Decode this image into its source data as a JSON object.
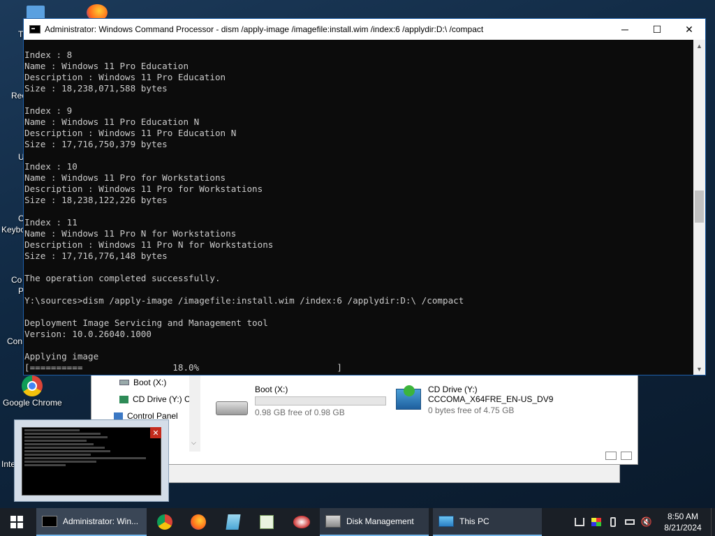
{
  "desktop": {
    "icons": [
      {
        "label": "Google Chrome"
      }
    ],
    "partial_labels": [
      "T",
      "Rec",
      "U",
      "C",
      "Keybo",
      "Co",
      "P",
      "Con",
      "Inte"
    ]
  },
  "cmd": {
    "title": "Administrator: Windows Command Processor - dism  /apply-image /imagefile:install.wim /index:6 /applydir:D:\\ /compact",
    "buttons": {
      "minimize": "─",
      "maximize": "☐",
      "close": "✕"
    },
    "lines": [
      "Index : 8",
      "Name : Windows 11 Pro Education",
      "Description : Windows 11 Pro Education",
      "Size : 18,238,071,588 bytes",
      "",
      "Index : 9",
      "Name : Windows 11 Pro Education N",
      "Description : Windows 11 Pro Education N",
      "Size : 17,716,750,379 bytes",
      "",
      "Index : 10",
      "Name : Windows 11 Pro for Workstations",
      "Description : Windows 11 Pro for Workstations",
      "Size : 18,238,122,226 bytes",
      "",
      "Index : 11",
      "Name : Windows 11 Pro N for Workstations",
      "Description : Windows 11 Pro N for Workstations",
      "Size : 17,716,776,148 bytes",
      "",
      "The operation completed successfully.",
      "",
      "Y:\\sources>dism /apply-image /imagefile:install.wim /index:6 /applydir:D:\\ /compact",
      "",
      "Deployment Image Servicing and Management tool",
      "Version: 10.0.26040.1000",
      "",
      "Applying image",
      "[==========                 18.0%                          ]"
    ],
    "progress": 0.18
  },
  "explorer": {
    "nav": {
      "boot": "Boot (X:)",
      "cd": "CD Drive (Y:) C",
      "control_panel": "Control Panel"
    },
    "drives": [
      {
        "name": "Boot (X:)",
        "free": "0.98 GB free of 0.98 GB",
        "used_fraction": 0.0
      },
      {
        "name": "CD Drive (Y:)",
        "label": "CCCOMA_X64FRE_EN-US_DV9",
        "free": "0 bytes free of 4.75 GB"
      }
    ]
  },
  "taskbar": {
    "tasks": {
      "cmd": "Administrator: Win...",
      "disk": "Disk Management",
      "thispc": "This PC"
    },
    "clock": {
      "time": "8:50 AM",
      "date": "8/21/2024"
    }
  }
}
